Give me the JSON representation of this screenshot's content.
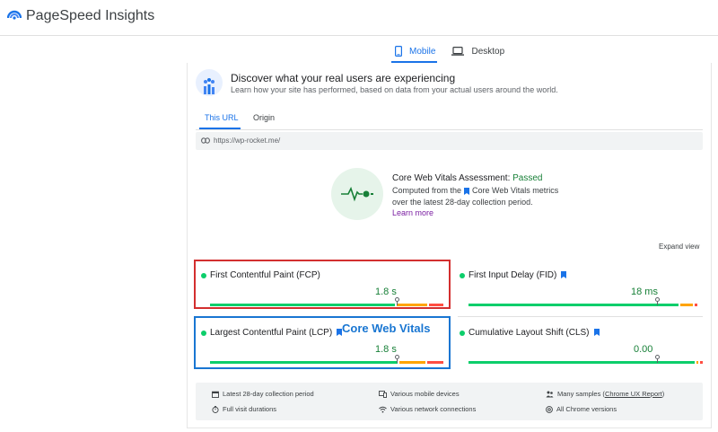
{
  "app": {
    "brand": "PageSpeed Insights"
  },
  "device_tabs": [
    {
      "label": "Mobile",
      "active": true
    },
    {
      "label": "Desktop",
      "active": false
    }
  ],
  "intro": {
    "title": "Discover what your real users are experiencing",
    "subtitle": "Learn how your site has performed, based on data from your actual users around the world."
  },
  "source_tabs": [
    {
      "label": "This URL",
      "active": true
    },
    {
      "label": "Origin",
      "active": false
    }
  ],
  "url": "https://wp-rocket.me/",
  "assessment": {
    "title_prefix": "Core Web Vitals Assessment: ",
    "status": "Passed",
    "line1_prefix": "Computed from the",
    "line1_suffix": "Core Web Vitals metrics",
    "line2": "over the latest 28-day collection period.",
    "learn_more": "Learn more"
  },
  "expand_view": "Expand view",
  "metrics": [
    {
      "name": "First Contentful Paint (FCP)",
      "value": "1.8 s",
      "cwv_flag": false,
      "pin": 0.8,
      "good": 0.8,
      "needs": 0.14,
      "poor": 0.06
    },
    {
      "name": "First Input Delay (FID)",
      "value": "18 ms",
      "cwv_flag": true,
      "pin": 0.8,
      "good": 0.9,
      "needs": 0.06,
      "poor": 0.01
    },
    {
      "name": "Largest Contentful Paint (LCP)",
      "value": "1.8 s",
      "cwv_flag": true,
      "pin": 0.8,
      "good": 0.81,
      "needs": 0.12,
      "poor": 0.07
    },
    {
      "name": "Cumulative Layout Shift (CLS)",
      "value": "0.00",
      "cwv_flag": true,
      "pin": 0.8,
      "good": 0.97,
      "needs": 0.01,
      "poor": 0.01
    }
  ],
  "overlay_label": "Core Web Vitals",
  "footer": {
    "period": "Latest 28-day collection period",
    "devices": "Various mobile devices",
    "samples_prefix": "Many samples (",
    "samples_link": "Chrome UX Report",
    "samples_suffix": ")",
    "durations": "Full visit durations",
    "network": "Various network connections",
    "versions": "All Chrome versions"
  },
  "colors": {
    "accent": "#1a73e8",
    "good": "#0cce6b",
    "needs_improvement": "#ffa400",
    "poor": "#ff4e42",
    "passed_text": "#188038",
    "highlight_red": "#d32f2f",
    "highlight_blue": "#1976d2"
  },
  "icons": {
    "logo": "pagespeed-logo-icon",
    "mobile": "phone-icon",
    "desktop": "laptop-icon",
    "users": "users-chart-icon",
    "link": "link-icon",
    "vitals": "heartbeat-icon",
    "flag": "bookmark-flag-icon",
    "calendar": "calendar-icon",
    "timer": "timer-icon",
    "devices": "devices-icon",
    "wifi": "wifi-icon",
    "people": "people-icon",
    "chrome": "chrome-icon"
  }
}
